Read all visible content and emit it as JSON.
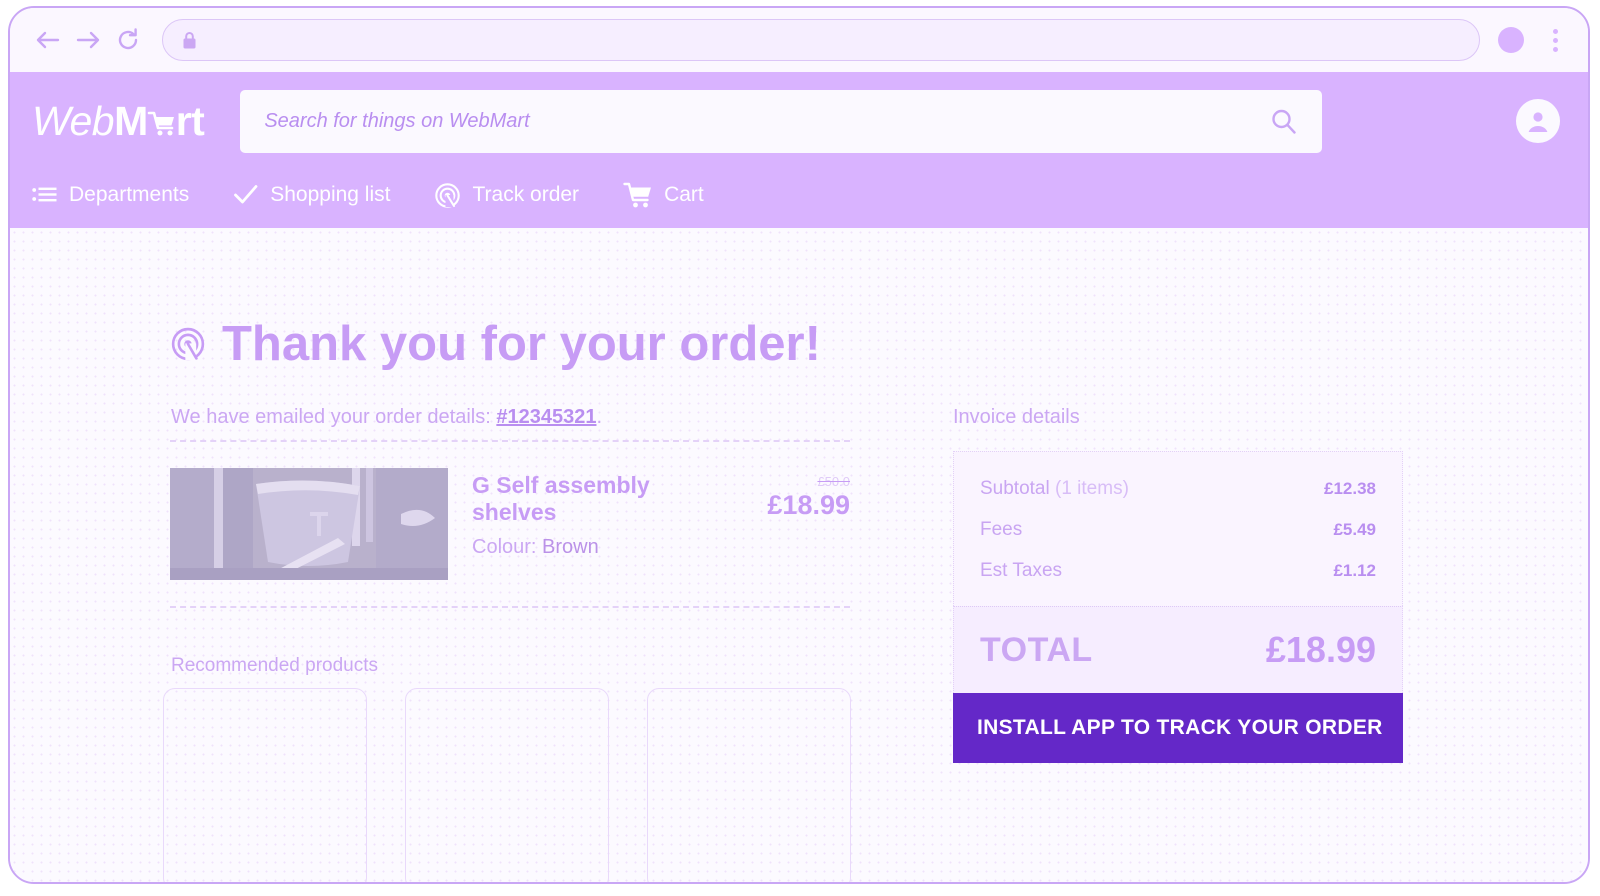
{
  "browser": {
    "back_icon": "back-arrow-icon",
    "forward_icon": "forward-arrow-icon",
    "reload_icon": "reload-icon",
    "lock_icon": "lock-icon",
    "url_value": "",
    "profile_icon": "profile-avatar-icon",
    "menu_icon": "kebab-menu-icon"
  },
  "header": {
    "logo": {
      "part1": "Web",
      "part2": "M",
      "cart_icon": "shopping-cart-icon",
      "part3": "rt"
    },
    "search": {
      "placeholder": "Search for things on WebMart",
      "value": "",
      "icon": "search-icon"
    },
    "account_icon": "account-circle-icon",
    "nav": [
      {
        "label": "Departments",
        "icon": "list-lines-icon"
      },
      {
        "label": "Shopping list",
        "icon": "checkmark-icon"
      },
      {
        "label": "Track order",
        "icon": "target-spiral-icon"
      },
      {
        "label": "Cart",
        "icon": "shopping-cart-icon"
      }
    ]
  },
  "main": {
    "headline": "Thank you for your order!",
    "headline_icon": "target-spiral-icon",
    "emailed_prefix": "We have emailed your order details: ",
    "order_number": "#12345321",
    "emailed_suffix": ".",
    "product": {
      "title": "G Self assembly shelves",
      "colour_label": "Colour: ",
      "colour_value": "Brown",
      "price_old": "£50.0",
      "price_new": "£18.99",
      "image_alt": "product-photo"
    },
    "recommended_title": "Recommended products",
    "recommended_count": 3
  },
  "invoice": {
    "title": "Invoice details",
    "lines": [
      {
        "label": "Subtotal",
        "sub": " (1 items)",
        "value": "£12.38"
      },
      {
        "label": "Fees",
        "sub": "",
        "value": "£5.49"
      },
      {
        "label": "Est Taxes",
        "sub": "",
        "value": "£1.12"
      }
    ],
    "total_label": "TOTAL",
    "total_value": "£18.99",
    "cta_label": "INSTALL APP TO TRACK YOUR ORDER"
  },
  "colors": {
    "brand_purple": "#d9b3ff",
    "accent_purple": "#c79cf5",
    "cta_purple": "#6428c8",
    "page_bg": "#fcfaff",
    "panel_bg": "#faf4ff",
    "total_bg": "#f6edff"
  }
}
